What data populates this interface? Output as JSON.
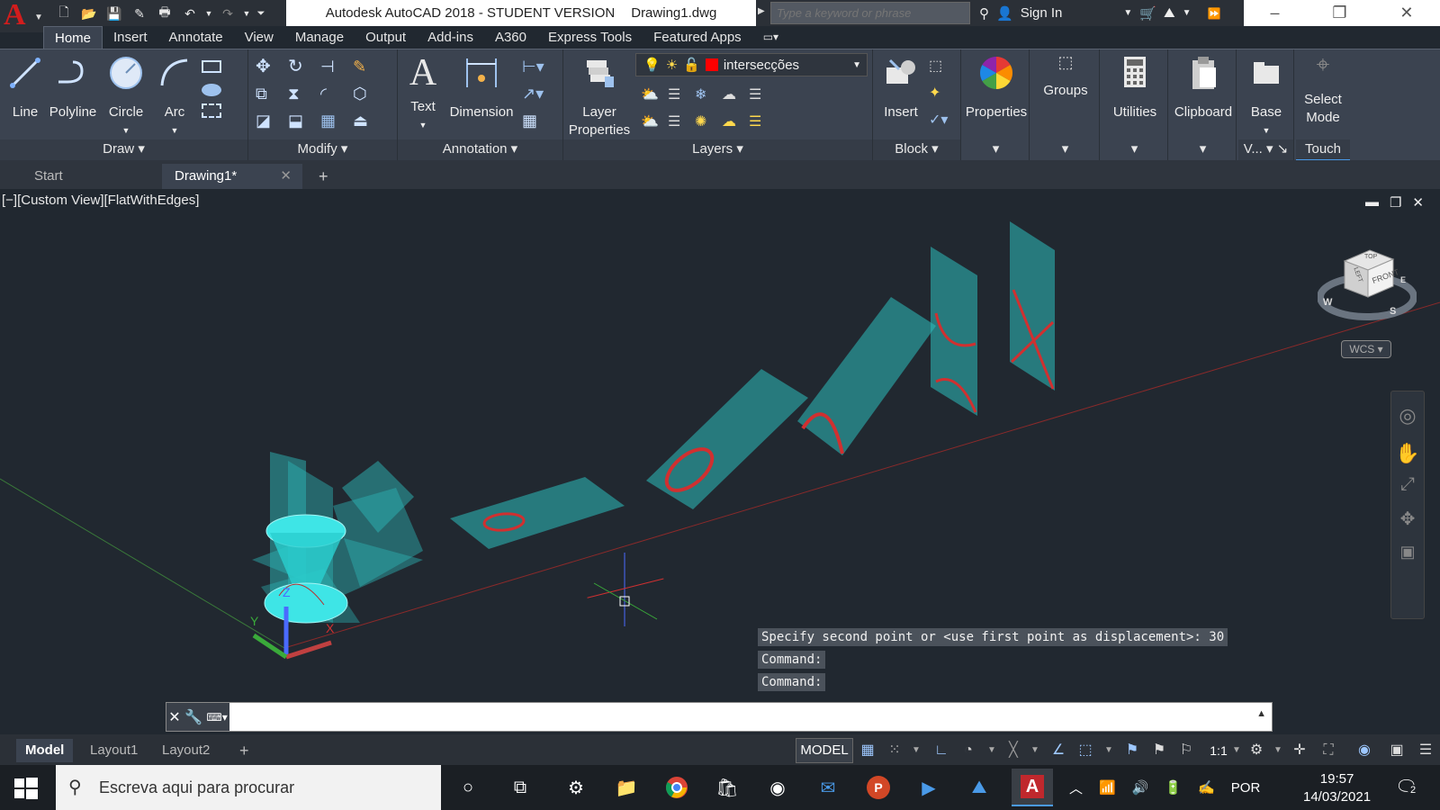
{
  "title_bar": {
    "app_title": "Autodesk AutoCAD 2018 - STUDENT VERSION",
    "file_name": "Drawing1.dwg",
    "search_placeholder": "Type a keyword or phrase",
    "sign_in": "Sign In"
  },
  "ribbon_tabs": [
    "Home",
    "Insert",
    "Annotate",
    "View",
    "Manage",
    "Output",
    "Add-ins",
    "A360",
    "Express Tools",
    "Featured Apps"
  ],
  "ribbon": {
    "draw": {
      "title": "Draw",
      "line": "Line",
      "polyline": "Polyline",
      "circle": "Circle",
      "arc": "Arc"
    },
    "modify": {
      "title": "Modify"
    },
    "annotation": {
      "title": "Annotation",
      "text": "Text",
      "dimension": "Dimension"
    },
    "layers": {
      "title": "Layers",
      "layer_properties": "Layer Properties",
      "current_layer": "intersecções",
      "layer_color": "#ff0000"
    },
    "block": {
      "title": "Block",
      "insert": "Insert"
    },
    "properties": "Properties",
    "groups": "Groups",
    "utilities": "Utilities",
    "clipboard": "Clipboard",
    "base": "Base",
    "view_short": "V...",
    "select_mode": "Select Mode",
    "touch": "Touch"
  },
  "doc_tabs": {
    "start": "Start",
    "drawing": "Drawing1*"
  },
  "viewport": {
    "label": "[−][Custom View][FlatWithEdges]",
    "viewcube_face1": "FRONT",
    "viewcube_face2": "LEFT",
    "viewcube_face3": "TOP",
    "compass_w": "W",
    "compass_s": "S",
    "compass_e": "E",
    "wcs": "WCS",
    "ucs_x": "X",
    "ucs_y": "Y",
    "ucs_z": "Z"
  },
  "command_history": [
    "Specify second point or <use first point as displacement>: 30",
    "Command:",
    "Command:"
  ],
  "layout_tabs": [
    "Model",
    "Layout1",
    "Layout2"
  ],
  "status_bar": {
    "model": "MODEL",
    "scale": "1:1"
  },
  "taskbar": {
    "search": "Escreva aqui para procurar",
    "language": "POR",
    "time": "19:57",
    "date": "14/03/2021",
    "notifications": "2"
  }
}
